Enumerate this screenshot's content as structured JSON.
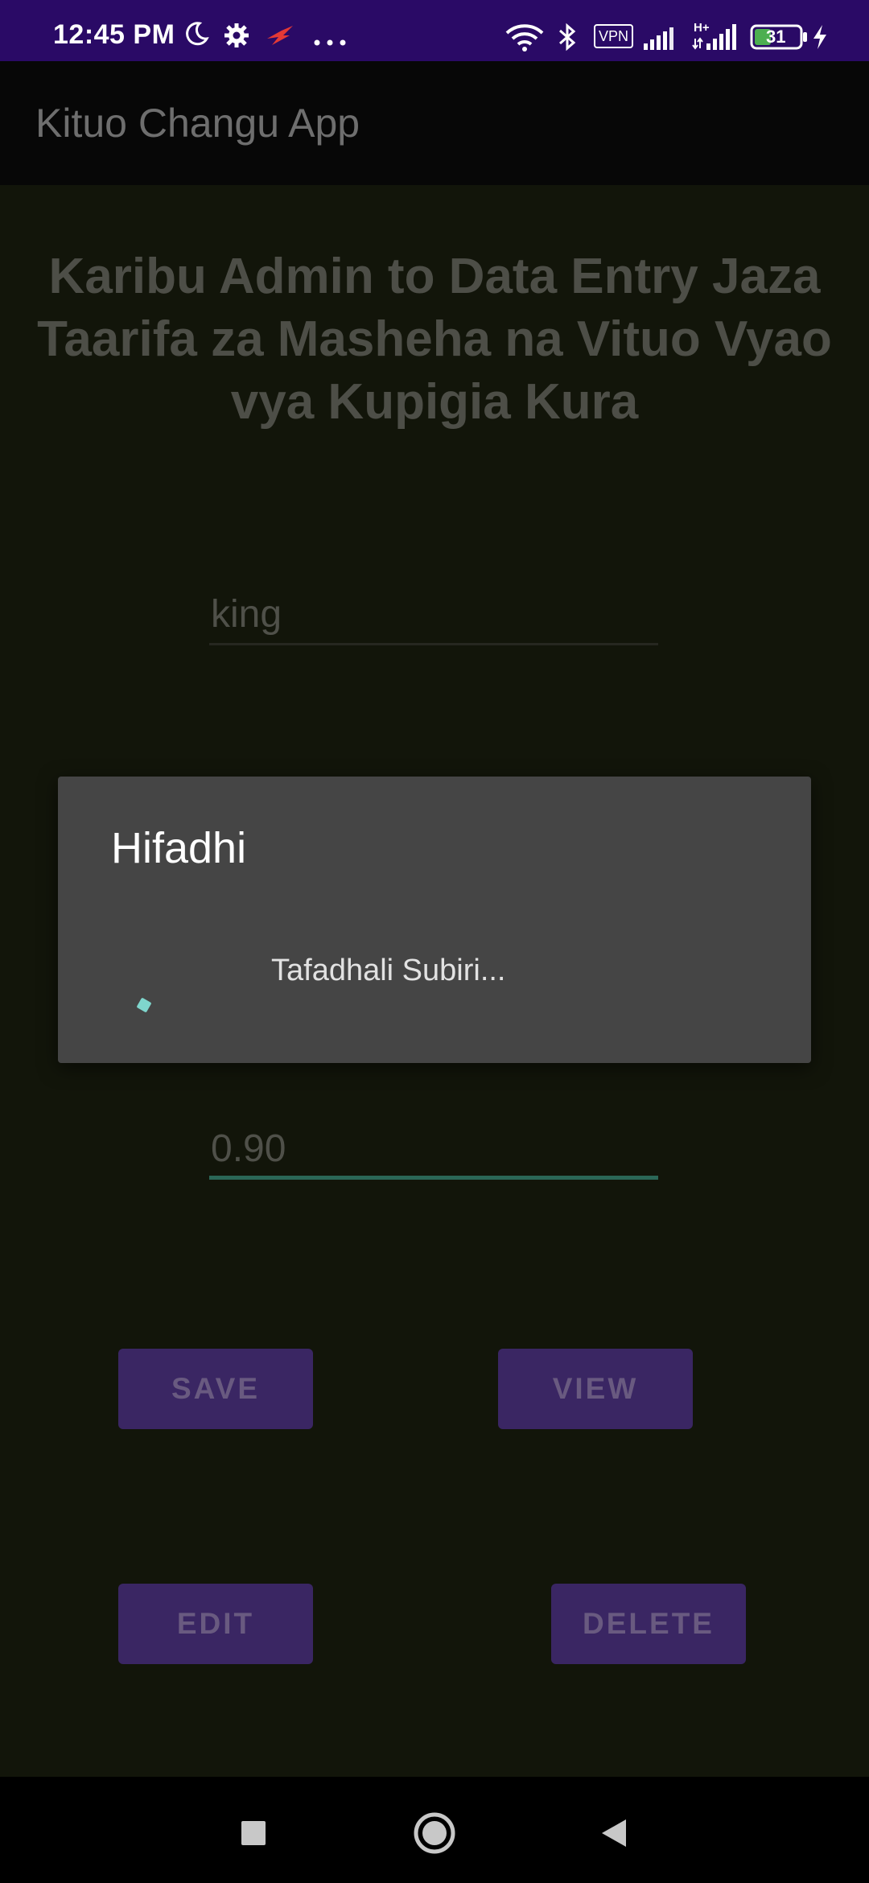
{
  "status_bar": {
    "time": "12:45 PM",
    "vpn_label": "VPN",
    "network_type": "H+",
    "battery_level": "31",
    "icons": [
      "moon-icon",
      "gear-icon",
      "app-notification-icon",
      "more-dots-icon",
      "wifi-icon",
      "bluetooth-icon",
      "vpn-icon",
      "signal-icon",
      "signal-hplus-icon",
      "battery-icon",
      "charging-icon"
    ]
  },
  "app_bar": {
    "title": "Kituo Changu App"
  },
  "main": {
    "welcome_text": "Karibu Admin to Data Entry Jaza Taarifa za Masheha na Vituo Vyao vya Kupigia Kura",
    "username_value": "king",
    "amount_value": "0.90",
    "buttons": {
      "save": "SAVE",
      "view": "VIEW",
      "edit": "EDIT",
      "delete": "DELETE"
    }
  },
  "dialog": {
    "title": "Hifadhi",
    "message": "Tafadhali Subiri..."
  },
  "nav_bar": {
    "icons": [
      "recents-square-icon",
      "home-circle-icon",
      "back-triangle-icon"
    ]
  },
  "colors": {
    "status_bar_bg": "#2a0a66",
    "app_bar_bg": "#070707",
    "screen_bg": "#12150a",
    "button_bg": "#3a2663",
    "dialog_bg": "#454545",
    "accent_teal": "#2b6757",
    "spinner": "#7fd6cd"
  }
}
